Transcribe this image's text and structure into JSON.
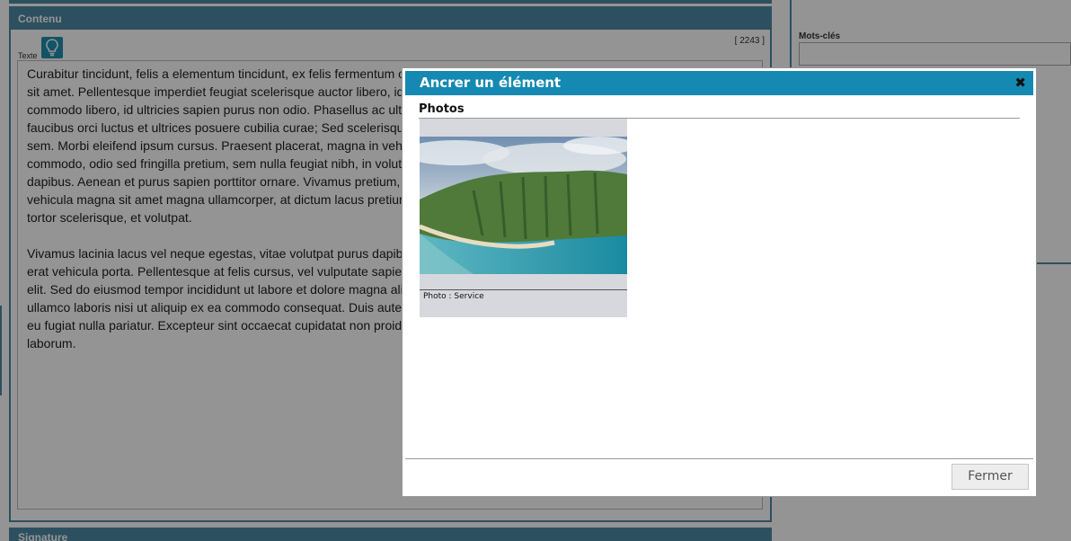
{
  "editor": {
    "contenu_title": "Contenu",
    "texte_label": "Texte",
    "char_count": "[ 2243 ]",
    "paragraph1": "Curabitur tincidunt, felis a elementum tincidunt, ex felis fermentum odio, vitae pretium pretium velit, eget volutpat justo fermentum sit amet. Pellentesque imperdiet feugiat scelerisque auctor libero, id volutpat est dignissim vitae. Aliquam erat volutpat. Integer commodo libero, id ultricies sapien purus non odio. Phasellus ac ultricies tortor, eu efficitur. Vestibulum ante ipsum primis in faucibus orci luctus et ultrices posuere cubilia curae; Sed scelerisque, lectus est interdum eros, sit amet bibendum eros sapien et sem. Morbi eleifend ipsum cursus. Praesent placerat, magna in vehicula vestibulum, ligula massa luctus libero. Vivamus commodo, odio sed fringilla pretium, sem nulla feugiat nibh, in volutpat. Fusce at nisi arcu. Quisque sed dolor nec dui scelerisque dapibus. Aenean et purus sapien porttitor ornare. Vivamus pretium, tortor at tempus ullamcorper, nunc tellus risus. Nullam vehicula magna sit amet magna ullamcorper, at dictum lacus pretium accumsan. Suspendisse potenti. Vivamus feugiat massa ut tortor scelerisque, et volutpat.",
    "paragraph2": "Vivamus lacinia lacus vel neque egestas, vitae volutpat purus dapibus. Nullam libero id ullamcorper interdum. Donec non urna et erat vehicula porta. Pellentesque at felis cursus, vel vulputate sapien suscipit. Lorem ipsum dolor sit amet, consectetur adipiscing elit. Sed do eiusmod tempor incididunt ut labore et dolore magna aliqua. Ut enim ad minim veniam, quis nostrud exercitation ullamco laboris nisi ut aliquip ex ea commodo consequat. Duis aute irure dolor in reprehenderit in voluptate velit esse cillum dolore eu fugiat nulla pariatur. Excepteur sint occaecat cupidatat non proident, sunt in culpa qui officia deserunt mollit anim id est laborum.",
    "signature_title": "Signature",
    "mots_cles_label": "Mots-clés"
  },
  "modal": {
    "title": "Ancrer un élément",
    "close_icon": "close-icon",
    "section_title": "Photos",
    "photo_caption": "Photo : Service",
    "close_button_label": "Fermer"
  },
  "colors": {
    "panel_blue": "#4f8aa6",
    "modal_header_blue": "#1589b1",
    "overlay": "rgba(0,0,0,0.42)"
  }
}
